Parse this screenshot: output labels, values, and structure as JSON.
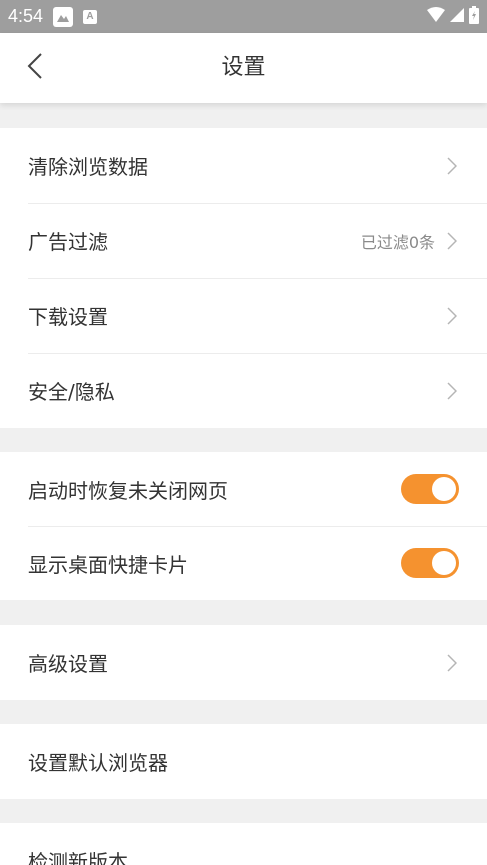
{
  "status_bar": {
    "time": "4:54",
    "app_icon_letter": "A"
  },
  "header": {
    "title": "设置",
    "back_icon": "chevron-left-icon"
  },
  "colors": {
    "accent": "#f5922f",
    "status_bar": "#9e9e9e",
    "background": "#f0f0f0"
  },
  "groups": {
    "browse": {
      "clear_data": "清除浏览数据",
      "ad_filter": "广告过滤",
      "ad_filter_value": "已过滤0条",
      "download_settings": "下载设置",
      "security_privacy": "安全/隐私"
    },
    "toggles": {
      "restore_pages": "启动时恢复未关闭网页",
      "restore_pages_on": true,
      "desktop_cards": "显示桌面快捷卡片",
      "desktop_cards_on": true
    },
    "advanced": {
      "label": "高级设置"
    },
    "default_browser": {
      "label": "设置默认浏览器"
    },
    "update": {
      "label": "检测新版本"
    }
  }
}
